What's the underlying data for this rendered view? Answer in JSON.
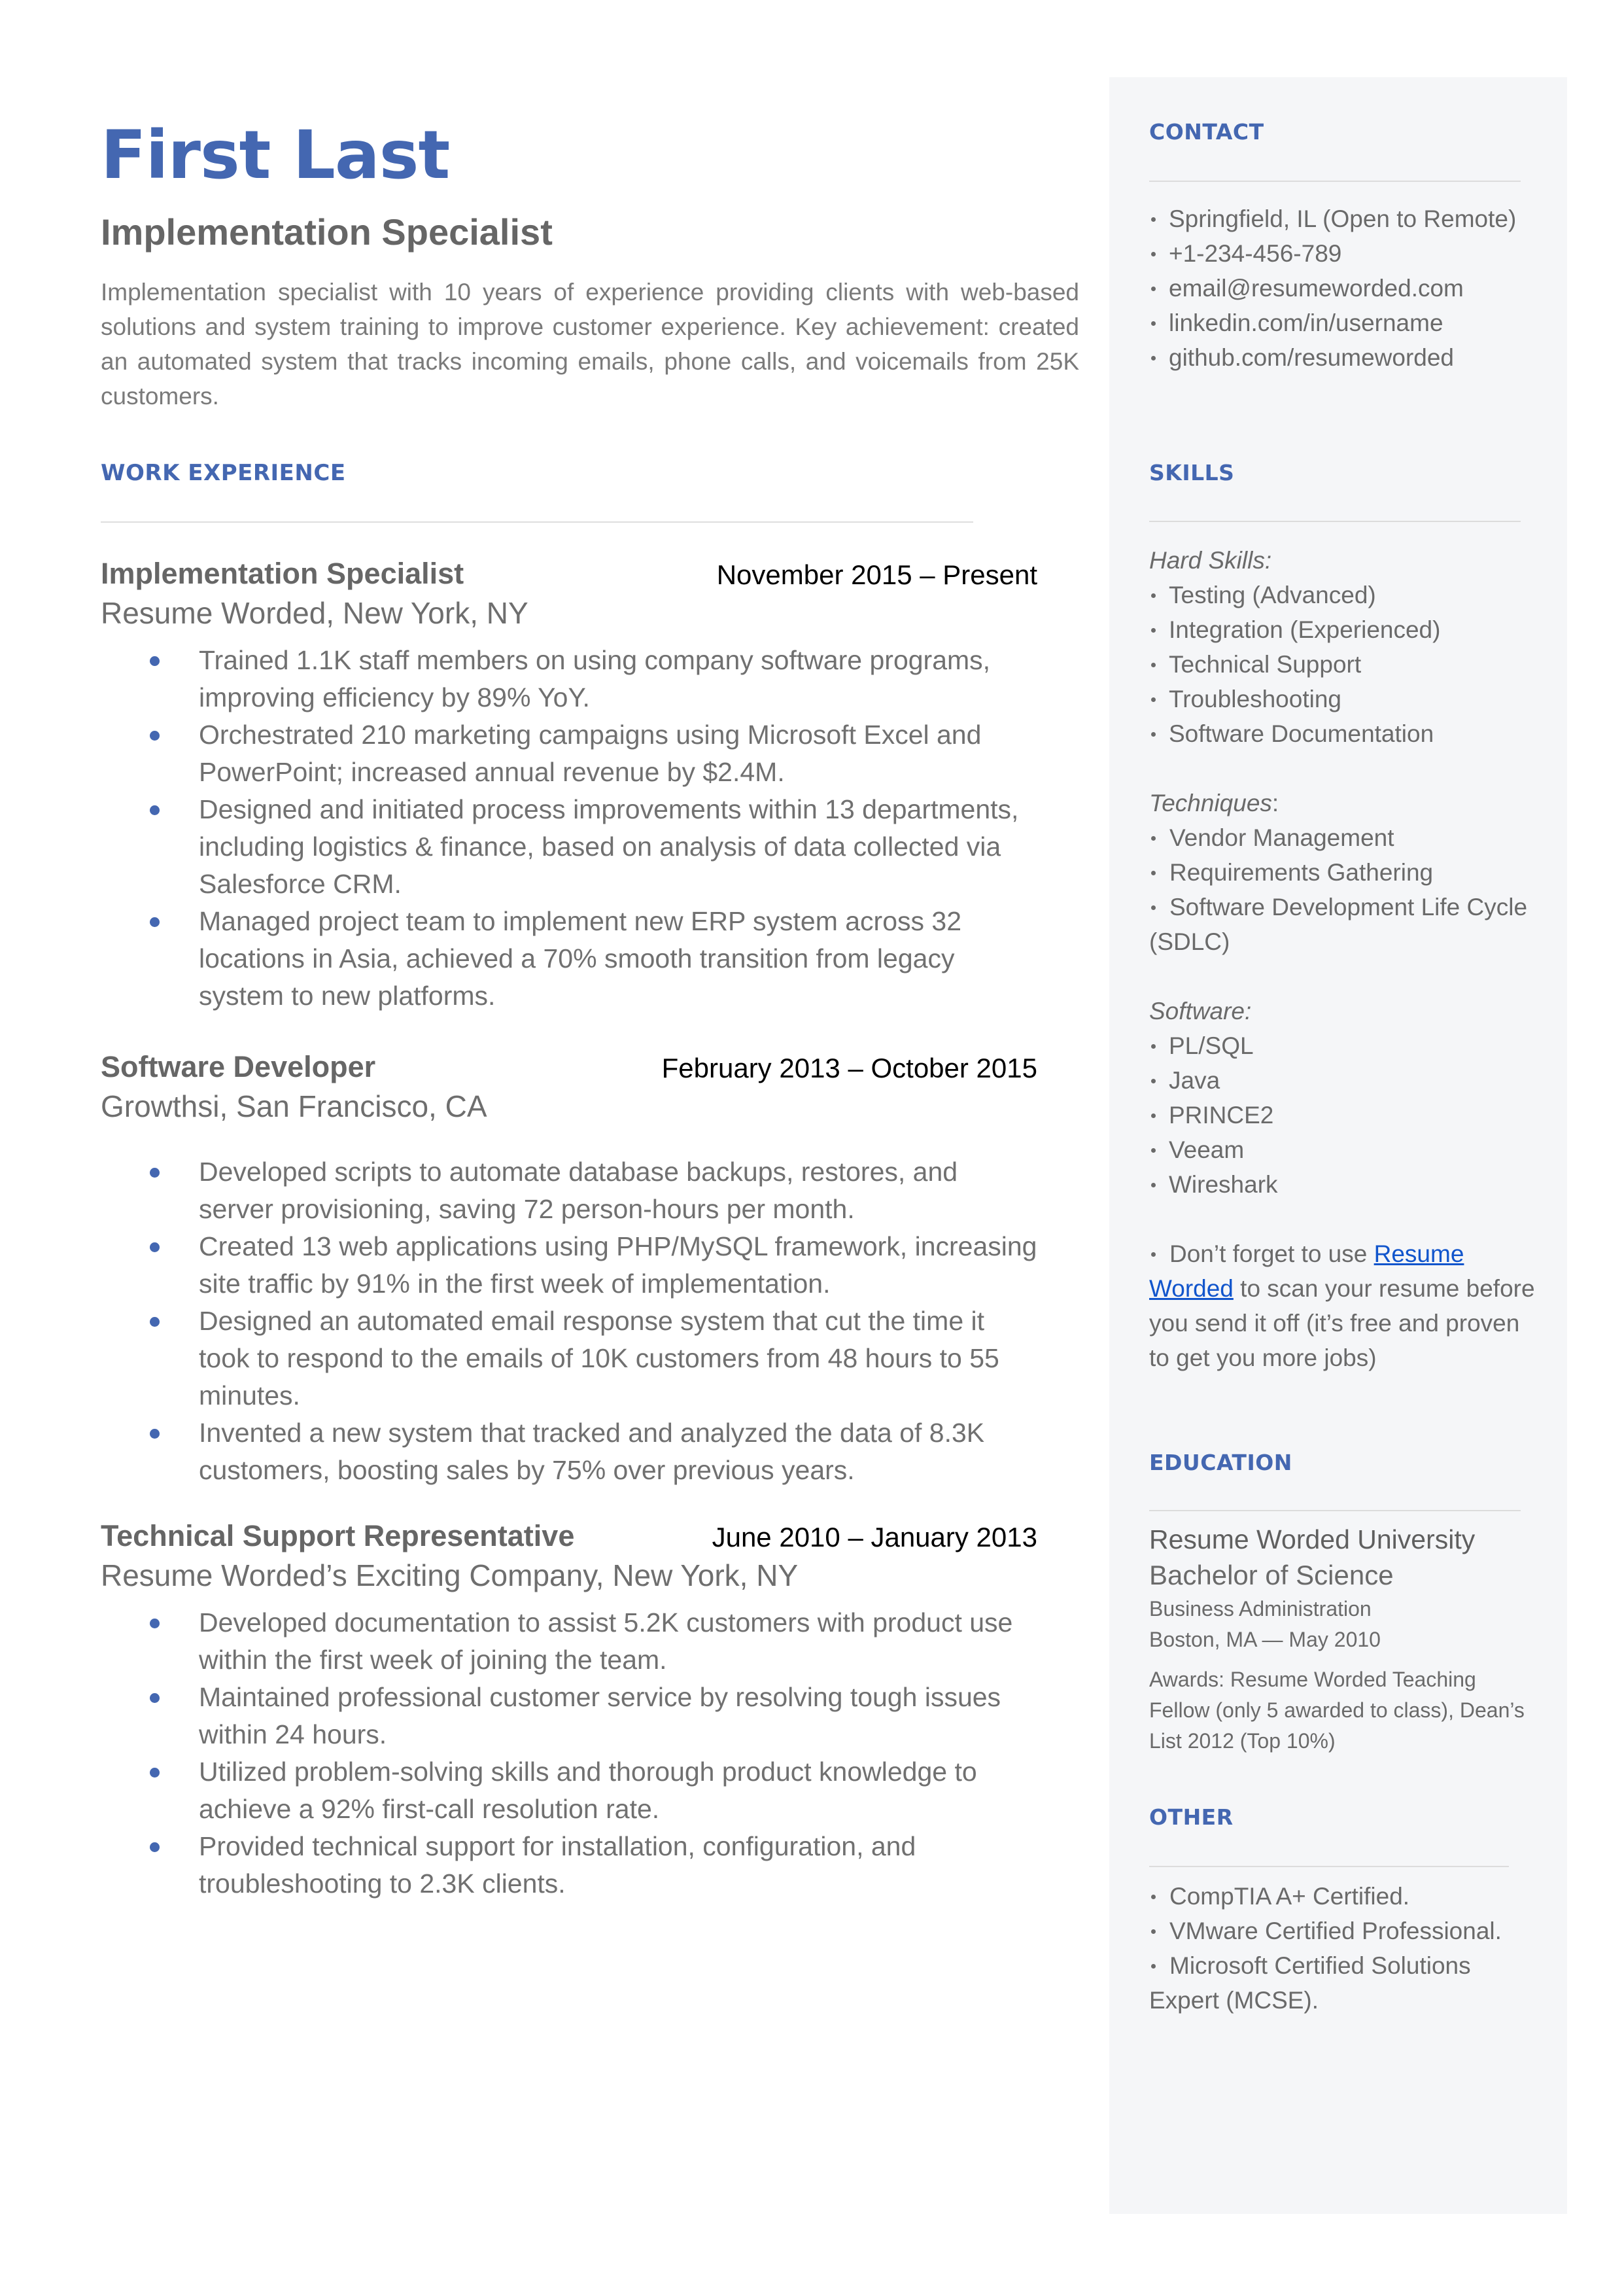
{
  "header": {
    "name": "First Last",
    "headline": "Implementation Specialist",
    "summary": "Implementation specialist with 10 years of experience providing clients with web-based solutions and system training to improve customer experience. Key achievement: created an automated system that tracks incoming emails, phone calls, and voicemails from 25K customers."
  },
  "work": {
    "title": "WORK EXPERIENCE",
    "jobs": [
      {
        "title": "Implementation Specialist",
        "dates": "November 2015 – Present",
        "company": "Resume Worded, New York, NY",
        "bullets": [
          "Trained 1.1K staff members on using company software programs, improving efficiency by 89% YoY.",
          "Orchestrated 210 marketing campaigns using Microsoft Excel and PowerPoint; increased annual revenue by $2.4M.",
          "Designed and initiated process improvements within  13 departments, including logistics & finance, based on analysis of data collected via Salesforce CRM.",
          "Managed project team to implement new ERP system across 32 locations in Asia, achieved a 70% smooth transition from legacy system to new platforms."
        ]
      },
      {
        "title": "Software Developer",
        "dates": "February 2013 – October 2015",
        "company": "Growthsi, San Francisco, CA",
        "bullets": [
          "Developed scripts to automate database backups, restores, and server provisioning, saving 72 person-hours per month.",
          "Created 13 web applications using PHP/MySQL framework, increasing site traffic by 91% in the first week of implementation.",
          "Designed an automated email response system that cut the time it took to respond to the emails of 10K customers from 48 hours to 55 minutes.",
          "Invented a new system that tracked and analyzed the data of 8.3K customers, boosting sales by 75% over previous years."
        ]
      },
      {
        "title": "Technical Support Representative",
        "dates": "June 2010 – January 2013",
        "company": "Resume Worded’s Exciting Company, New York, NY",
        "bullets": [
          "Developed documentation to assist 5.2K customers with product use within the first week of joining the team.",
          "Maintained professional customer service by resolving tough issues within 24 hours.",
          "Utilized problem-solving skills and thorough product knowledge to achieve a 92% first-call resolution rate.",
          "Provided technical support for installation, configuration, and troubleshooting to 2.3K clients."
        ]
      }
    ]
  },
  "sidebar": {
    "contact": {
      "title": "CONTACT",
      "items": [
        " Springfield, IL (Open to Remote)",
        "+1-234-456-789",
        "email@resumeworded.com",
        "linkedin.com/in/username",
        "github.com/resumeworded"
      ]
    },
    "skills": {
      "title": "SKILLS",
      "hard_label": "Hard Skills:",
      "hard": [
        "Testing (Advanced)",
        "Integration (Experienced)",
        "Technical Support",
        "Troubleshooting",
        "Software Documentation"
      ],
      "techniques_label": "Techniques",
      "techniques_colon": ":",
      "techniques": [
        "Vendor Management",
        "Requirements Gathering",
        "Software Development Life Cycle (SDLC)"
      ],
      "software_label": "Software:",
      "software": [
        "PL/SQL",
        "Java",
        "PRINCE2",
        "Veeam",
        "Wireshark"
      ],
      "tip_prefix": "Don’t forget to use ",
      "tip_link": "Resume Worded",
      "tip_suffix": " to scan your resume before you send it off (it’s free and proven to get you more jobs)"
    },
    "education": {
      "title": "EDUCATION",
      "school": "Resume Worded University",
      "degree": "Bachelor of Science",
      "field": "Business Administration",
      "location_date": "Boston, MA — May 2010",
      "awards": "Awards: Resume Worded Teaching Fellow (only 5 awarded to class), Dean’s List 2012 (Top 10%)"
    },
    "other": {
      "title": "OTHER",
      "items": [
        "CompTIA A+ Certified.",
        "VMware Certified Professional.",
        "Microsoft Certified Solutions Expert (MCSE)."
      ]
    }
  },
  "colors": {
    "accent": "#4467b1",
    "sidebar_bg": "#f5f6f8",
    "link": "#1155cc",
    "body_text": "#666666"
  }
}
